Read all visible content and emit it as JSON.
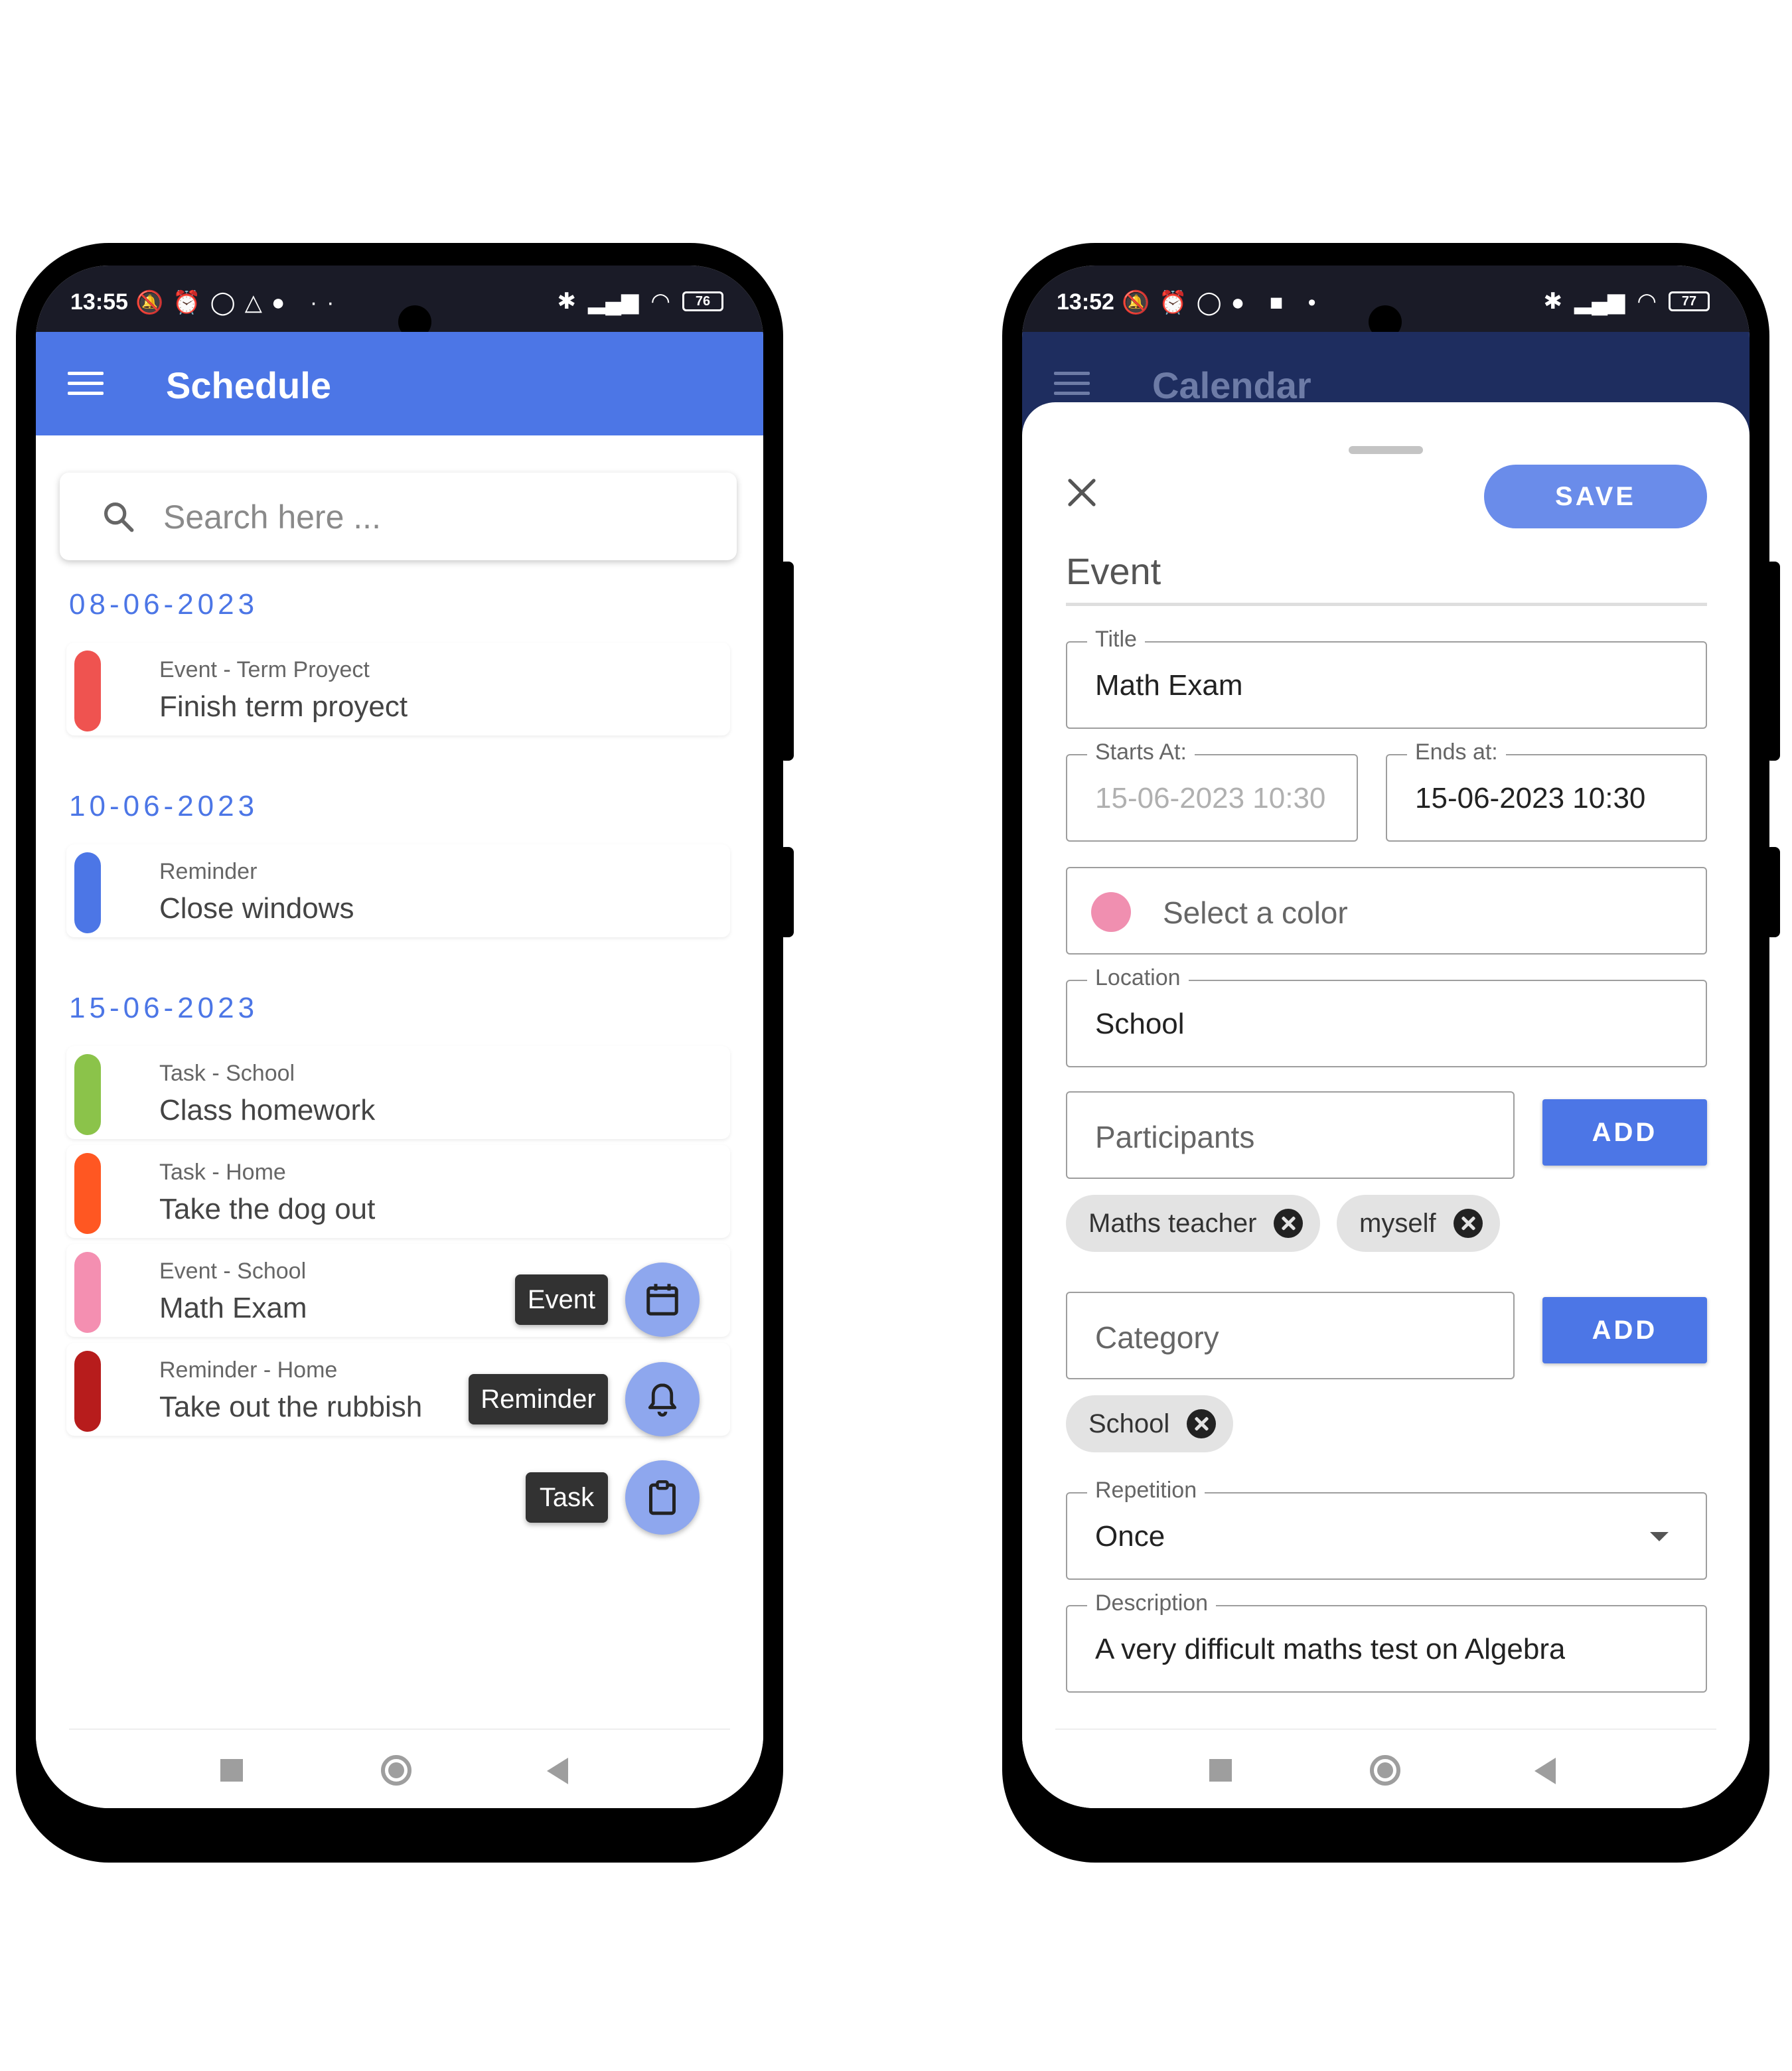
{
  "left_phone": {
    "status": {
      "time": "13:55",
      "left_icons": "🔕⏰◯△● ··",
      "battery": "76"
    },
    "app_bar": {
      "title": "Schedule"
    },
    "search": {
      "placeholder": "Search here ..."
    },
    "groups": [
      {
        "date": "08-06-2023",
        "items": [
          {
            "subtitle": "Event - Term Proyect",
            "title": "Finish term proyect",
            "color": "#ef5350"
          }
        ]
      },
      {
        "date": "10-06-2023",
        "items": [
          {
            "subtitle": "Reminder",
            "title": "Close windows",
            "color": "#4c76e6"
          }
        ]
      },
      {
        "date": "15-06-2023",
        "items": [
          {
            "subtitle": "Task - School",
            "title": "Class homework",
            "color": "#8bc34a"
          },
          {
            "subtitle": "Task - Home",
            "title": "Take the dog out",
            "color": "#ff5722"
          },
          {
            "subtitle": "Event - School",
            "title": "Math Exam",
            "color": "#f48fb1"
          },
          {
            "subtitle": "Reminder - Home",
            "title": "Take out the rubbish",
            "color": "#b71c1c"
          }
        ]
      }
    ],
    "fab_menu": {
      "event_label": "Event",
      "reminder_label": "Reminder",
      "task_label": "Task",
      "close_symbol": "✕"
    }
  },
  "right_phone": {
    "status": {
      "time": "13:52",
      "left_icons": "🔕⏰◯● ■  •",
      "battery": "77"
    },
    "app_bar": {
      "title": "Calendar"
    },
    "form": {
      "save_label": "SAVE",
      "section_title": "Event",
      "title": {
        "label": "Title",
        "value": "Math Exam"
      },
      "starts_at": {
        "label": "Starts At:",
        "value": "15-06-2023 10:30"
      },
      "ends_at": {
        "label": "Ends at:",
        "value": "15-06-2023 10:30"
      },
      "color": {
        "placeholder": "Select a color",
        "value_color": "#f08fb0"
      },
      "location": {
        "label": "Location",
        "value": "School"
      },
      "participants": {
        "placeholder": "Participants",
        "add_label": "ADD",
        "chips": [
          "Maths teacher",
          "myself"
        ]
      },
      "category": {
        "placeholder": "Category",
        "add_label": "ADD",
        "chips": [
          "School"
        ]
      },
      "repetition": {
        "label": "Repetition",
        "value": "Once"
      },
      "description": {
        "label": "Description",
        "value": "A very difficult maths test on Algebra"
      }
    }
  }
}
